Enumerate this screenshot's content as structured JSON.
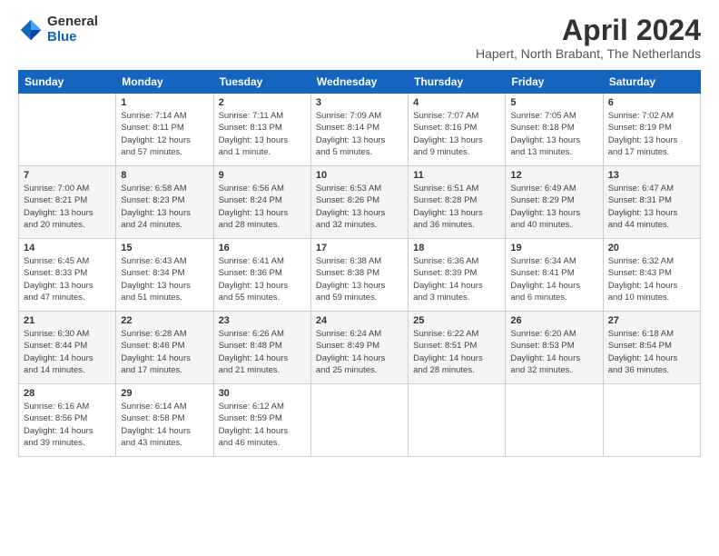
{
  "logo": {
    "general": "General",
    "blue": "Blue"
  },
  "header": {
    "title": "April 2024",
    "subtitle": "Hapert, North Brabant, The Netherlands"
  },
  "columns": [
    "Sunday",
    "Monday",
    "Tuesday",
    "Wednesday",
    "Thursday",
    "Friday",
    "Saturday"
  ],
  "weeks": [
    [
      {
        "day": "",
        "info": ""
      },
      {
        "day": "1",
        "info": "Sunrise: 7:14 AM\nSunset: 8:11 PM\nDaylight: 12 hours\nand 57 minutes."
      },
      {
        "day": "2",
        "info": "Sunrise: 7:11 AM\nSunset: 8:13 PM\nDaylight: 13 hours\nand 1 minute."
      },
      {
        "day": "3",
        "info": "Sunrise: 7:09 AM\nSunset: 8:14 PM\nDaylight: 13 hours\nand 5 minutes."
      },
      {
        "day": "4",
        "info": "Sunrise: 7:07 AM\nSunset: 8:16 PM\nDaylight: 13 hours\nand 9 minutes."
      },
      {
        "day": "5",
        "info": "Sunrise: 7:05 AM\nSunset: 8:18 PM\nDaylight: 13 hours\nand 13 minutes."
      },
      {
        "day": "6",
        "info": "Sunrise: 7:02 AM\nSunset: 8:19 PM\nDaylight: 13 hours\nand 17 minutes."
      }
    ],
    [
      {
        "day": "7",
        "info": "Sunrise: 7:00 AM\nSunset: 8:21 PM\nDaylight: 13 hours\nand 20 minutes."
      },
      {
        "day": "8",
        "info": "Sunrise: 6:58 AM\nSunset: 8:23 PM\nDaylight: 13 hours\nand 24 minutes."
      },
      {
        "day": "9",
        "info": "Sunrise: 6:56 AM\nSunset: 8:24 PM\nDaylight: 13 hours\nand 28 minutes."
      },
      {
        "day": "10",
        "info": "Sunrise: 6:53 AM\nSunset: 8:26 PM\nDaylight: 13 hours\nand 32 minutes."
      },
      {
        "day": "11",
        "info": "Sunrise: 6:51 AM\nSunset: 8:28 PM\nDaylight: 13 hours\nand 36 minutes."
      },
      {
        "day": "12",
        "info": "Sunrise: 6:49 AM\nSunset: 8:29 PM\nDaylight: 13 hours\nand 40 minutes."
      },
      {
        "day": "13",
        "info": "Sunrise: 6:47 AM\nSunset: 8:31 PM\nDaylight: 13 hours\nand 44 minutes."
      }
    ],
    [
      {
        "day": "14",
        "info": "Sunrise: 6:45 AM\nSunset: 8:33 PM\nDaylight: 13 hours\nand 47 minutes."
      },
      {
        "day": "15",
        "info": "Sunrise: 6:43 AM\nSunset: 8:34 PM\nDaylight: 13 hours\nand 51 minutes."
      },
      {
        "day": "16",
        "info": "Sunrise: 6:41 AM\nSunset: 8:36 PM\nDaylight: 13 hours\nand 55 minutes."
      },
      {
        "day": "17",
        "info": "Sunrise: 6:38 AM\nSunset: 8:38 PM\nDaylight: 13 hours\nand 59 minutes."
      },
      {
        "day": "18",
        "info": "Sunrise: 6:36 AM\nSunset: 8:39 PM\nDaylight: 14 hours\nand 3 minutes."
      },
      {
        "day": "19",
        "info": "Sunrise: 6:34 AM\nSunset: 8:41 PM\nDaylight: 14 hours\nand 6 minutes."
      },
      {
        "day": "20",
        "info": "Sunrise: 6:32 AM\nSunset: 8:43 PM\nDaylight: 14 hours\nand 10 minutes."
      }
    ],
    [
      {
        "day": "21",
        "info": "Sunrise: 6:30 AM\nSunset: 8:44 PM\nDaylight: 14 hours\nand 14 minutes."
      },
      {
        "day": "22",
        "info": "Sunrise: 6:28 AM\nSunset: 8:46 PM\nDaylight: 14 hours\nand 17 minutes."
      },
      {
        "day": "23",
        "info": "Sunrise: 6:26 AM\nSunset: 8:48 PM\nDaylight: 14 hours\nand 21 minutes."
      },
      {
        "day": "24",
        "info": "Sunrise: 6:24 AM\nSunset: 8:49 PM\nDaylight: 14 hours\nand 25 minutes."
      },
      {
        "day": "25",
        "info": "Sunrise: 6:22 AM\nSunset: 8:51 PM\nDaylight: 14 hours\nand 28 minutes."
      },
      {
        "day": "26",
        "info": "Sunrise: 6:20 AM\nSunset: 8:53 PM\nDaylight: 14 hours\nand 32 minutes."
      },
      {
        "day": "27",
        "info": "Sunrise: 6:18 AM\nSunset: 8:54 PM\nDaylight: 14 hours\nand 36 minutes."
      }
    ],
    [
      {
        "day": "28",
        "info": "Sunrise: 6:16 AM\nSunset: 8:56 PM\nDaylight: 14 hours\nand 39 minutes."
      },
      {
        "day": "29",
        "info": "Sunrise: 6:14 AM\nSunset: 8:58 PM\nDaylight: 14 hours\nand 43 minutes."
      },
      {
        "day": "30",
        "info": "Sunrise: 6:12 AM\nSunset: 8:59 PM\nDaylight: 14 hours\nand 46 minutes."
      },
      {
        "day": "",
        "info": ""
      },
      {
        "day": "",
        "info": ""
      },
      {
        "day": "",
        "info": ""
      },
      {
        "day": "",
        "info": ""
      }
    ]
  ]
}
